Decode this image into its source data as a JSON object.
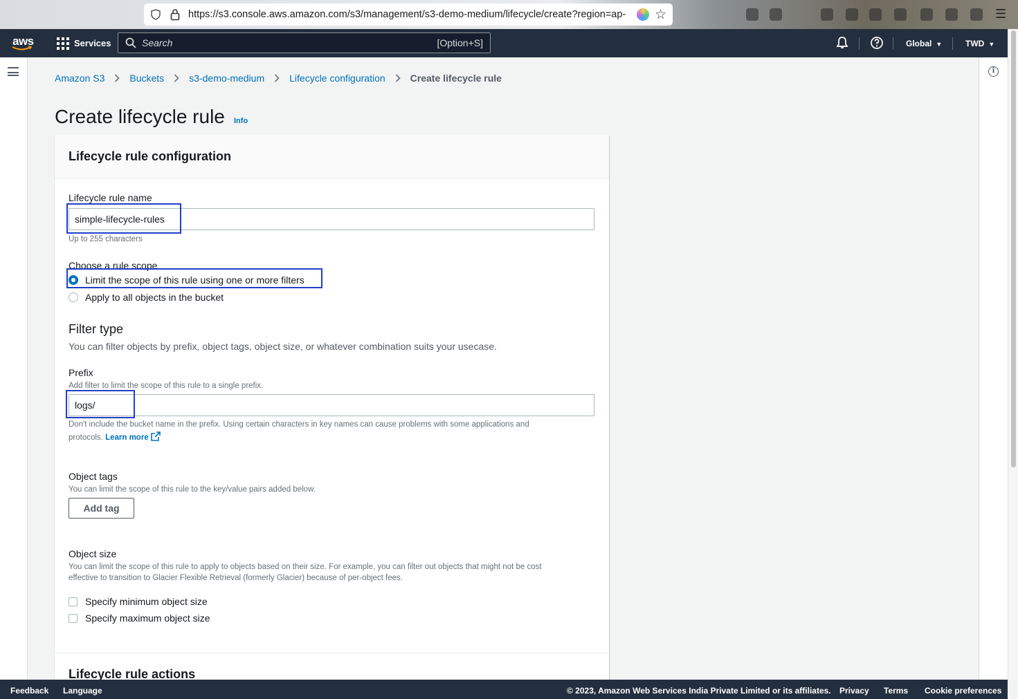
{
  "browser": {
    "url": "https://s3.console.aws.amazon.com/s3/management/s3-demo-medium/lifecycle/create?region=ap-"
  },
  "nav": {
    "logo": "aws",
    "services_label": "Services",
    "search_placeholder": "Search",
    "search_shortcut": "[Option+S]",
    "region_label": "Global",
    "account_label": "TWD"
  },
  "breadcrumb": {
    "items": [
      "Amazon S3",
      "Buckets",
      "s3-demo-medium",
      "Lifecycle configuration"
    ],
    "current": "Create lifecycle rule"
  },
  "page": {
    "title": "Create lifecycle rule",
    "info_link": "Info"
  },
  "config": {
    "panel_title": "Lifecycle rule configuration",
    "rule_name_label": "Lifecycle rule name",
    "rule_name_value": "simple-lifecycle-rules",
    "rule_name_hint": "Up to 255 characters",
    "scope_label": "Choose a rule scope",
    "scope_options": [
      {
        "label": "Limit the scope of this rule using one or more filters",
        "selected": true
      },
      {
        "label": "Apply to all objects in the bucket",
        "selected": false
      }
    ],
    "filter_type_title": "Filter type",
    "filter_type_desc": "You can filter objects by prefix, object tags, object size, or whatever combination suits your usecase.",
    "prefix_label": "Prefix",
    "prefix_desc": "Add filter to limit the scope of this rule to a single prefix.",
    "prefix_value": "logs/",
    "prefix_hint_line1": "Don't include the bucket name in the prefix. Using certain characters in key names can cause problems with some applications and",
    "prefix_hint_line2": "protocols.",
    "learn_more": "Learn more",
    "tags_label": "Object tags",
    "tags_desc": "You can limit the scope of this rule to the key/value pairs added below.",
    "add_tag_button": "Add tag",
    "size_label": "Object size",
    "size_desc_line1": "You can limit the scope of this rule to apply to objects based on their size. For example, you can filter out objects that might not be cost",
    "size_desc_line2": "effective to transition to Glacier Flexible Retrieval (formerly Glacier) because of per-object fees.",
    "size_options": [
      {
        "label": "Specify minimum object size",
        "checked": false
      },
      {
        "label": "Specify maximum object size",
        "checked": false
      }
    ],
    "actions_title": "Lifecycle rule actions"
  },
  "footer": {
    "feedback": "Feedback",
    "language": "Language",
    "copyright": "© 2023, Amazon Web Services India Private Limited or its affiliates.",
    "privacy": "Privacy",
    "terms": "Terms",
    "cookies": "Cookie preferences"
  },
  "colors": {
    "nav_bg": "#232f3e",
    "link": "#0073bb",
    "highlight_box": "#1f3fc8"
  }
}
